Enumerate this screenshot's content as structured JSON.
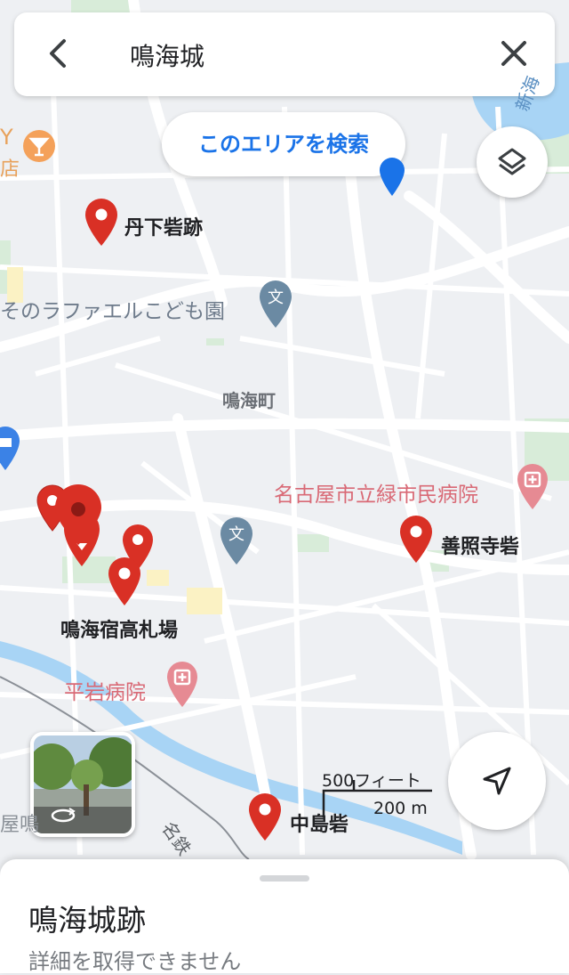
{
  "search": {
    "query": "鳴海城"
  },
  "search_area_button": {
    "label": "このエリアを検索"
  },
  "map_labels": {
    "tange": "丹下砦跡",
    "kindergarten": "そのラファエルこども園",
    "town": "鳴海町",
    "hospital_midori": "名古屋市立緑市民病院",
    "zensho": "善照寺砦",
    "kosatsuba": "鳴海宿高札場",
    "hiraiwa": "平岩病院",
    "nakashima": "中島砦",
    "meitetsu": "名鉄",
    "left_edge": "屋鳴",
    "top_left_char": "店",
    "top_left_letter": "Y",
    "river_top": "新海"
  },
  "scale": {
    "imperial": "500フィート",
    "metric": "200 m"
  },
  "place_sheet": {
    "title": "鳴海城跡",
    "subtitle": "詳細を取得できません"
  },
  "colors": {
    "accent": "#1a73e8",
    "pin": "#d93025",
    "water": "#a8d4f5",
    "park": "#c8e6c9"
  },
  "icons": [
    "back-arrow-icon",
    "close-icon",
    "layers-icon",
    "navigate-icon",
    "school-icon",
    "hospital-icon",
    "bar-icon",
    "shopping-icon",
    "transit-icon",
    "rotate-360-icon",
    "map-pin-icon"
  ]
}
